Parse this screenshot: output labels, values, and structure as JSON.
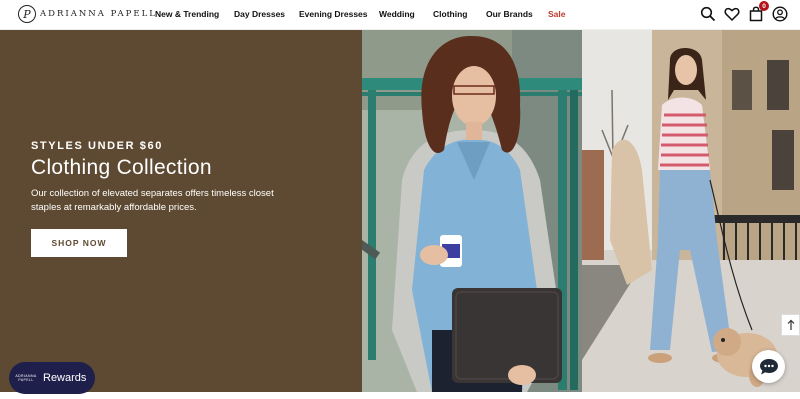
{
  "brand": {
    "logo_text": "ADRIANNA PAPELL",
    "logo_mark": "P"
  },
  "nav": {
    "items": [
      {
        "label": "New & Trending"
      },
      {
        "label": "Day Dresses"
      },
      {
        "label": "Evening Dresses"
      },
      {
        "label": "Wedding"
      },
      {
        "label": "Clothing"
      },
      {
        "label": "Our Brands"
      },
      {
        "label": "Sale"
      }
    ]
  },
  "header_icons": {
    "search": "search-icon",
    "wishlist": "heart-icon",
    "cart": "cart-icon",
    "cart_count": "0",
    "account": "account-icon"
  },
  "hero": {
    "eyebrow": "STYLES UNDER $60",
    "title": "Clothing Collection",
    "description": "Our collection of elevated separates offers timeless closet staples at remarkably affordable prices.",
    "cta_label": "SHOP NOW",
    "panel_color": "#5e4a32"
  },
  "rewards": {
    "label": "Rewards",
    "logo_line1": "ADRIANNA",
    "logo_line2": "PAPELL"
  },
  "accent_colors": {
    "sale": "#c0392b",
    "rewards": "#1e1f4b",
    "badge": "#b3121b"
  }
}
